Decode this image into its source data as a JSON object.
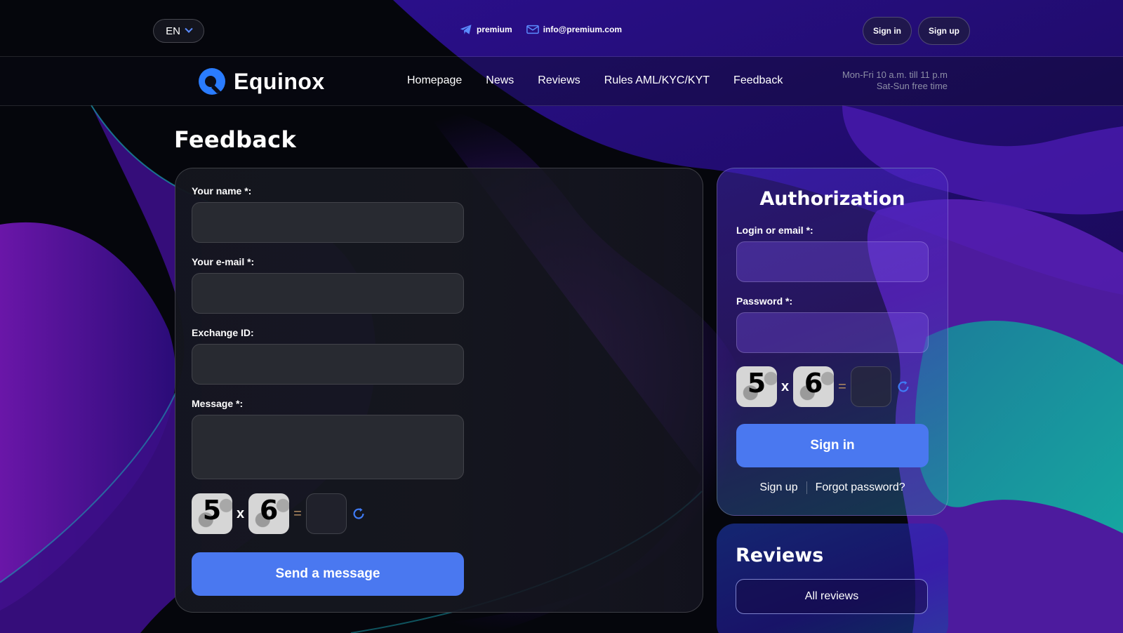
{
  "topbar": {
    "language": "EN",
    "telegram": "premium",
    "email": "info@premium.com",
    "signin": "Sign in",
    "signup": "Sign up"
  },
  "brand": {
    "name": "Equinox"
  },
  "nav": {
    "items": [
      "Homepage",
      "News",
      "Reviews",
      "Rules AML/KYC/KYT",
      "Feedback"
    ]
  },
  "hours": {
    "line1": "Mon-Fri 10 a.m. till 11 p.m",
    "line2": "Sat-Sun free time"
  },
  "feedback": {
    "title": "Feedback",
    "name_label": "Your name *:",
    "email_label": "Your e-mail *:",
    "exchange_label": "Exchange ID:",
    "message_label": "Message *:",
    "captcha": {
      "a": "5",
      "op": "x",
      "b": "6",
      "eq": "="
    },
    "submit": "Send a message"
  },
  "auth": {
    "title": "Authorization",
    "login_label": "Login or email *:",
    "password_label": "Password *:",
    "captcha": {
      "a": "5",
      "op": "x",
      "b": "6",
      "eq": "="
    },
    "submit": "Sign in",
    "signup_link": "Sign up",
    "forgot_link": "Forgot password?"
  },
  "reviews": {
    "title": "Reviews",
    "all": "All reviews"
  },
  "colors": {
    "accent": "#4a78f0",
    "refresh": "#3f7bf5"
  }
}
